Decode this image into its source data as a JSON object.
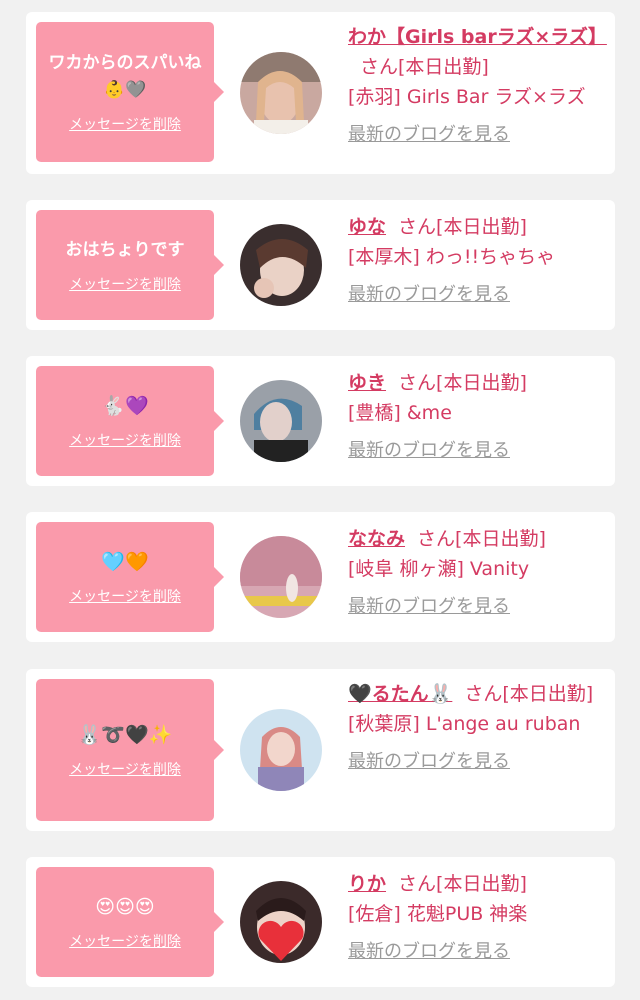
{
  "colors": {
    "background": "#f1f1f1",
    "card": "#ffffff",
    "bubble": "#fa9aab",
    "accent_text": "#d43b62",
    "link_gray": "#9a9a9a"
  },
  "delete_label": "メッセージを削除",
  "blog_label": "最新のブログを見る",
  "honorific": "さん",
  "status": "[本日出勤]",
  "messages": [
    {
      "message": "ワカからのスパいね👶🩶",
      "name": "わか【Girls barラズ×ラズ】",
      "shop": "[赤羽] Girls Bar ラズ×ラズ",
      "avatar": "avatar-photo-blonde-girl"
    },
    {
      "message": "おはちょりです",
      "name": "ゆな",
      "shop": "[本厚木] わっ!!ちゃちゃ",
      "avatar": "avatar-photo-girl-hand"
    },
    {
      "message": "🐇💜",
      "name": "ゆき",
      "shop": "[豊橋] &me",
      "avatar": "avatar-photo-blue-hair"
    },
    {
      "message": "🩵🧡",
      "name": "ななみ",
      "shop": "[岐阜 柳ヶ瀬] Vanity",
      "avatar": "avatar-photo-flowers"
    },
    {
      "message": "🐰➰🖤✨",
      "name": "🖤るたん🐰",
      "shop": "[秋葉原] L'ange au ruban",
      "avatar": "avatar-photo-idol"
    },
    {
      "message": "😍😍😍",
      "name": "りか",
      "shop": "[佐倉] 花魁PUB 神楽",
      "avatar": "avatar-photo-heart-face"
    }
  ]
}
